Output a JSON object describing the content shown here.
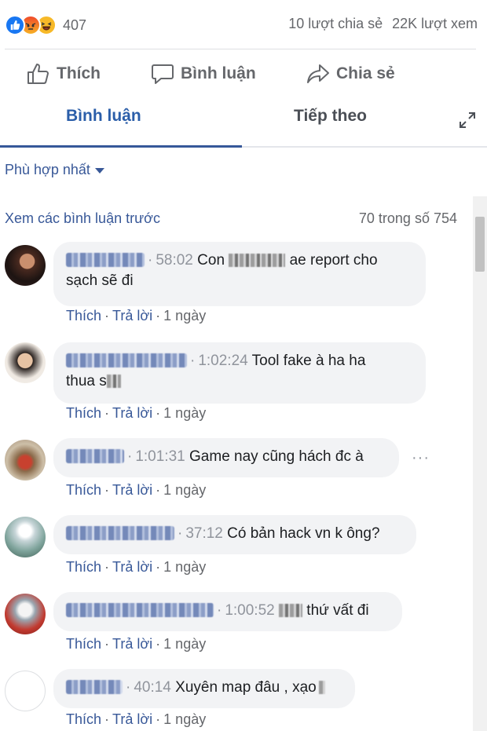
{
  "reactions": {
    "count": "407",
    "types": [
      "like-icon",
      "angry-icon",
      "haha-icon"
    ],
    "colors": {
      "like": "#1877f2",
      "angry": "#f05a28",
      "haha": "#f7b928"
    }
  },
  "stats": {
    "shares": "10 lượt chia sẻ",
    "views": "22K lượt xem"
  },
  "actions": {
    "like": "Thích",
    "comment": "Bình luận",
    "share": "Chia sẻ"
  },
  "tabs": {
    "comments": "Bình luận",
    "next": "Tiếp theo"
  },
  "sort": {
    "label": "Phù hợp nhất"
  },
  "comments_header": {
    "prev": "Xem các bình luận trước",
    "pager": "70 trong số 754"
  },
  "meta_labels": {
    "like": "Thích",
    "reply": "Trả lời",
    "dot": "·"
  },
  "comments": [
    {
      "time": "58:02",
      "text_a": "Con",
      "text_b": "ae report cho",
      "text_c": "sạch sẽ đi",
      "age": "1 ngày"
    },
    {
      "time": "1:02:24",
      "text_a": "Tool fake à ha ha",
      "text_b": "thua s",
      "age": "1 ngày"
    },
    {
      "time": "1:01:31",
      "text_a": "Game nay cũng hách đc à",
      "age": "1 ngày"
    },
    {
      "time": "37:12",
      "text_a": "Có bản hack vn k ông?",
      "age": "1 ngày"
    },
    {
      "time": "1:00:52",
      "text_a": "thứ vất đi",
      "age": "1 ngày"
    },
    {
      "time": "40:14",
      "text_a": "Xuyên map đâu , xạo",
      "age": "1 ngày"
    }
  ]
}
